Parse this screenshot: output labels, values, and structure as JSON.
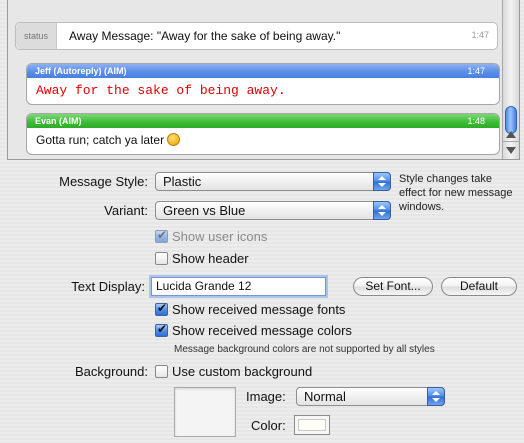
{
  "preview": {
    "status": {
      "tag": "status",
      "text": "Away Message: \"Away for the sake of being away.\"",
      "time": "1:47"
    },
    "messages": [
      {
        "sender": "Jeff (Autoreply) (AIM)",
        "time": "1:47",
        "text": "Away for the sake of being away.",
        "header_color": "#5b8ee8",
        "text_color": "#e00000"
      },
      {
        "sender": "Evan (AIM)",
        "time": "1:48",
        "text": "Gotta run; catch ya later",
        "header_color": "#3fbd38",
        "emoticon": "smiley-icon"
      }
    ]
  },
  "settings": {
    "message_style": {
      "label": "Message Style:",
      "value": "Plastic"
    },
    "style_note": "Style changes take effect for new message windows.",
    "variant": {
      "label": "Variant:",
      "value": "Green vs Blue"
    },
    "show_user_icons": {
      "label": "Show user icons",
      "checked": true,
      "enabled": false
    },
    "show_header": {
      "label": "Show header",
      "checked": false,
      "enabled": true
    },
    "text_display": {
      "label": "Text Display:",
      "value": "Lucida Grande 12",
      "set_font_button": "Set Font...",
      "default_button": "Default"
    },
    "show_received_fonts": {
      "label": "Show received message fonts",
      "checked": true
    },
    "show_received_colors": {
      "label": "Show received message colors",
      "checked": true
    },
    "colors_note": "Message background colors are not supported by all styles",
    "background": {
      "label": "Background:",
      "use_custom_label": "Use custom background",
      "use_custom_checked": false,
      "image_label": "Image:",
      "image_value": "Normal",
      "color_label": "Color:",
      "color_value": "#fffef7"
    }
  }
}
